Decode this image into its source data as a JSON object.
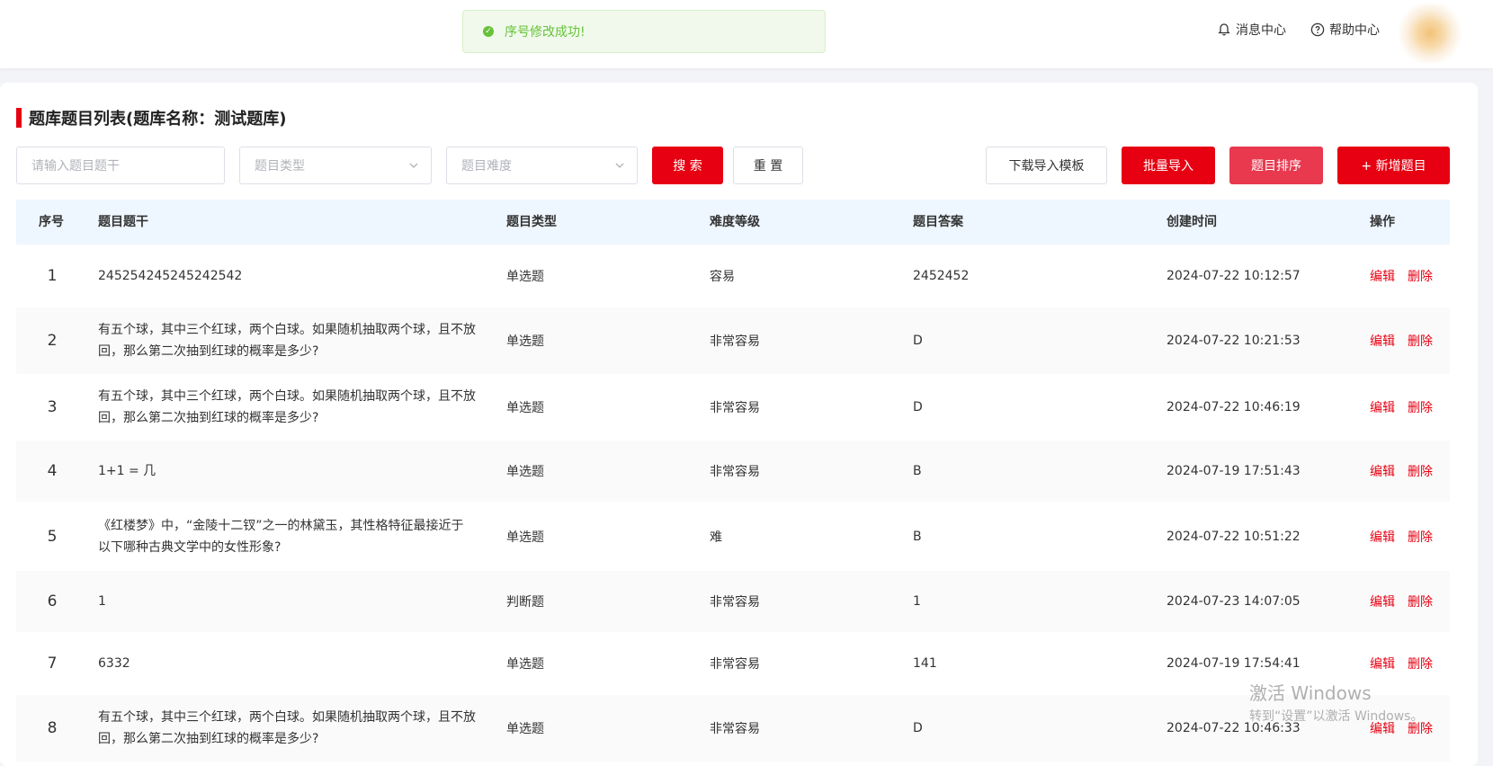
{
  "toast": {
    "message": "序号修改成功!",
    "icon": "check-circle-icon",
    "color": "#67c23a"
  },
  "header": {
    "messages_label": "消息中心",
    "help_label": "帮助中心"
  },
  "page": {
    "title": "题库题目列表(题库名称：测试题库)"
  },
  "filters": {
    "stem_placeholder": "请输入题目题干",
    "type_placeholder": "题目类型",
    "difficulty_placeholder": "题目难度"
  },
  "toolbar": {
    "search_label": "搜 索",
    "reset_label": "重 置",
    "download_template_label": "下载导入模板",
    "batch_import_label": "批量导入",
    "sort_label": "题目排序",
    "add_label": "+ 新增题目"
  },
  "colors": {
    "accent": "#e60012",
    "sort_button": "#e8394f",
    "header_bg": "#eef6ff"
  },
  "table": {
    "columns": [
      "序号",
      "题目题干",
      "题目类型",
      "难度等级",
      "题目答案",
      "创建时间",
      "操作"
    ],
    "rows": [
      {
        "idx": "1",
        "stem": "245254245245242542",
        "type": "单选题",
        "difficulty": "容易",
        "answer": "2452452",
        "created": "2024-07-22 10:12:57",
        "edit": "编辑",
        "delete": "删除"
      },
      {
        "idx": "2",
        "stem": "有五个球，其中三个红球，两个白球。如果随机抽取两个球，且不放回，那么第二次抽到红球的概率是多少?",
        "type": "单选题",
        "difficulty": "非常容易",
        "answer": "D",
        "created": "2024-07-22 10:21:53",
        "edit": "编辑",
        "delete": "删除"
      },
      {
        "idx": "3",
        "stem": "有五个球，其中三个红球，两个白球。如果随机抽取两个球，且不放回，那么第二次抽到红球的概率是多少?",
        "type": "单选题",
        "difficulty": "非常容易",
        "answer": "D",
        "created": "2024-07-22 10:46:19",
        "edit": "编辑",
        "delete": "删除"
      },
      {
        "idx": "4",
        "stem": "1+1 = 几",
        "type": "单选题",
        "difficulty": "非常容易",
        "answer": "B",
        "created": "2024-07-19 17:51:43",
        "edit": "编辑",
        "delete": "删除"
      },
      {
        "idx": "5",
        "stem": "《红楼梦》中，“金陵十二钗”之一的林黛玉，其性格特征最接近于以下哪种古典文学中的女性形象?",
        "type": "单选题",
        "difficulty": "难",
        "answer": "B",
        "created": "2024-07-22 10:51:22",
        "edit": "编辑",
        "delete": "删除"
      },
      {
        "idx": "6",
        "stem": "1",
        "type": "判断题",
        "difficulty": "非常容易",
        "answer": "1",
        "created": "2024-07-23 14:07:05",
        "edit": "编辑",
        "delete": "删除"
      },
      {
        "idx": "7",
        "stem": "6332",
        "type": "单选题",
        "difficulty": "非常容易",
        "answer": "141",
        "created": "2024-07-19 17:54:41",
        "edit": "编辑",
        "delete": "删除"
      },
      {
        "idx": "8",
        "stem": "有五个球，其中三个红球，两个白球。如果随机抽取两个球，且不放回，那么第二次抽到红球的概率是多少?",
        "type": "单选题",
        "difficulty": "非常容易",
        "answer": "D",
        "created": "2024-07-22 10:46:33",
        "edit": "编辑",
        "delete": "删除"
      }
    ]
  },
  "watermark": {
    "line1": "激活 Windows",
    "line2": "转到“设置”以激活 Windows。"
  }
}
